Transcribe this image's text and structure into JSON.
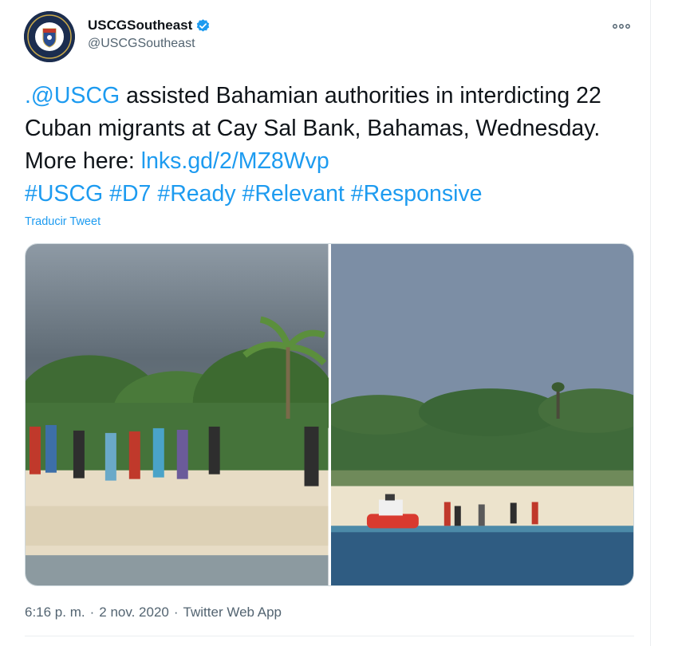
{
  "account": {
    "display_name": "USCGSoutheast",
    "handle": "@USCGSoutheast",
    "verified": true
  },
  "icons": {
    "more": "more-horizontal-icon",
    "verified": "verified-badge-icon"
  },
  "tweet": {
    "text_parts": [
      {
        "text": ".@USCG",
        "link": true
      },
      {
        "text": " assisted Bahamian authorities in interdicting 22 Cuban migrants at Cay Sal Bank, Bahamas, Wednesday. More here: ",
        "link": false
      },
      {
        "text": "lnks.gd/2/MZ8Wvp",
        "link": true
      }
    ],
    "hashtags": [
      "#USCG",
      "#D7",
      "#Ready",
      "#Relevant",
      "#Responsive"
    ],
    "translate_label": "Traducir Tweet"
  },
  "meta": {
    "time": "6:16 p. m.",
    "separator1": "·",
    "date": "2 nov. 2020",
    "separator2": "·",
    "source": "Twitter Web App"
  },
  "colors": {
    "link": "#1d9bf0",
    "text": "#0f1419",
    "secondary": "#536471"
  }
}
